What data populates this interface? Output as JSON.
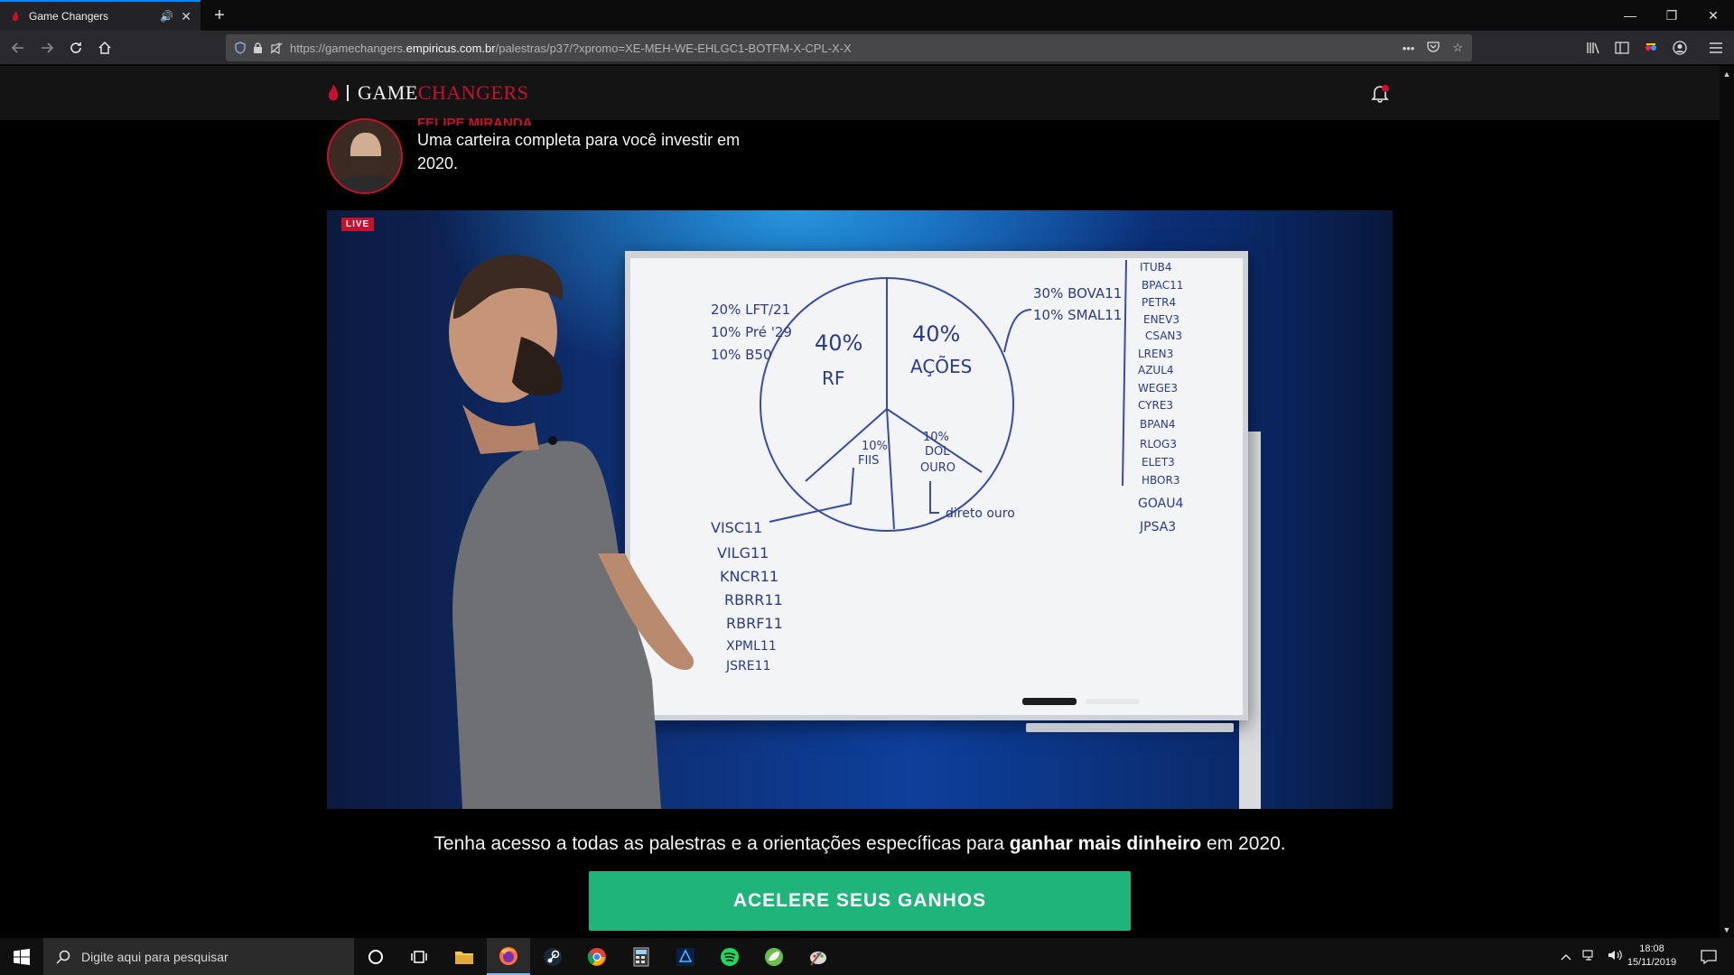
{
  "browser": {
    "tab_title": "Game Changers",
    "url_prefix": "https://gamechangers.",
    "url_domain": "empiricus.com.br",
    "url_path": "/palestras/p37/?xpromo=XE-MEH-WE-EHLGC1-BOTFM-X-CPL-X-X",
    "new_tab_label": "+",
    "page_actions_label": "•••"
  },
  "site": {
    "logo_game": "GAME",
    "logo_changers": "CHANGERS",
    "speaker_name": "FELIPE MIRANDA",
    "talk_title": "Uma carteira completa para você investir em 2020.",
    "live_label": "LIVE",
    "cta_text_before": "Tenha acesso a todas as palestras e a orientações específicas para ",
    "cta_text_bold": "ganhar mais dinheiro",
    "cta_text_after": " em 2020.",
    "cta_button": "ACELERE SEUS GANHOS",
    "brand_red": "#c8102e",
    "cta_green": "#1eb47a"
  },
  "whiteboard": {
    "left_notes": [
      "20% LFT/21",
      "10% Pré '29",
      "10% B50"
    ],
    "slice_rf": [
      "40%",
      "RF"
    ],
    "slice_acoes": [
      "40%",
      "AÇÕES"
    ],
    "slice_fiis": [
      "10%",
      "FIIS"
    ],
    "slice_dol": [
      "10%",
      "DOL",
      "OURO"
    ],
    "right_notes": [
      "30% BOVA11",
      "10% SMAL11"
    ],
    "direct_gold": "direto ouro",
    "fii_list": [
      "VISC11",
      "VILG11",
      "KNCR11",
      "RBRR11",
      "RBRF11",
      "XPML11",
      "JSRE11"
    ],
    "stock_list": [
      "ITUB4",
      "BPAC11",
      "PETR4",
      "ENEV3",
      "CSAN3",
      "LREN3",
      "AZUL4",
      "WEGE3",
      "CYRE3",
      "BPAN4",
      "RLOG3",
      "ELET3",
      "HBOR3",
      "GOAU4",
      "JPSA3"
    ]
  },
  "taskbar": {
    "search_placeholder": "Digite aqui para pesquisar",
    "time": "18:08",
    "date": "15/11/2019"
  }
}
